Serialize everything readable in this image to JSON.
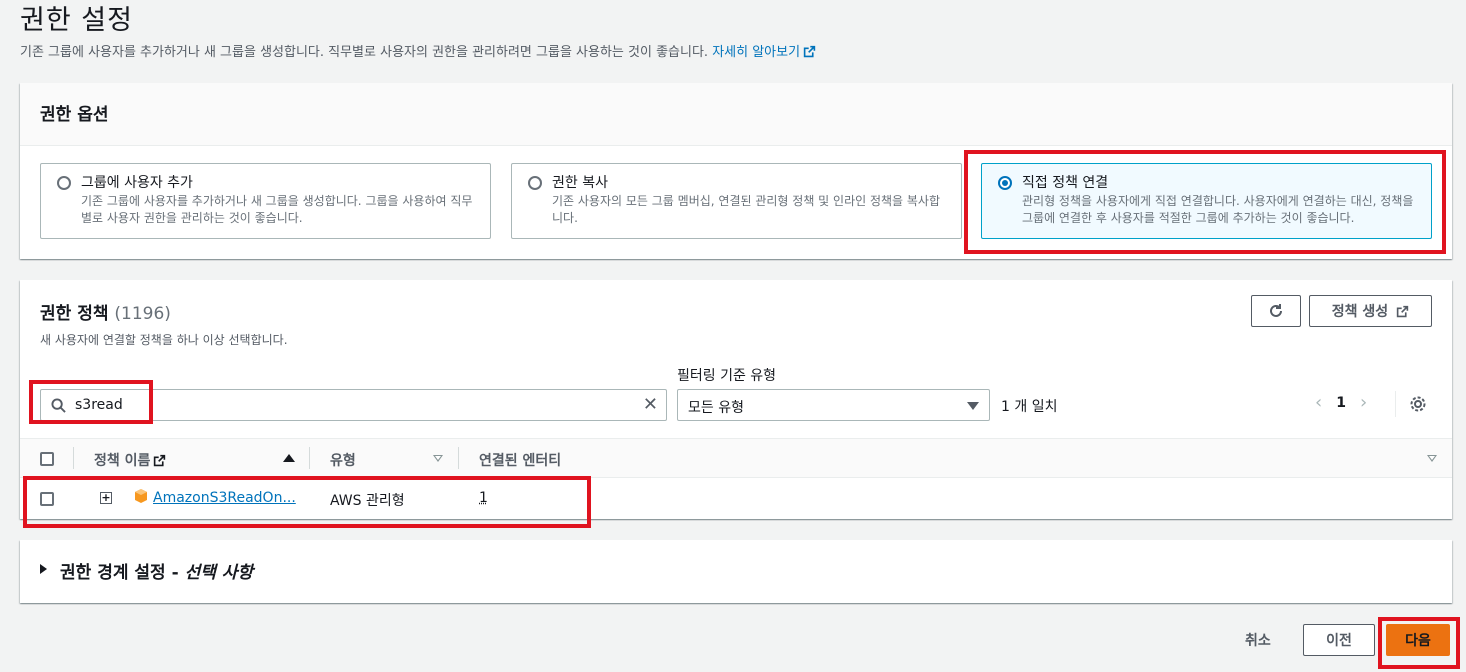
{
  "page": {
    "title": "권한 설정",
    "description": "기존 그룹에 사용자를 추가하거나 새 그룹을 생성합니다. 직무별로 사용자의 권한을 관리하려면 그룹을 사용하는 것이 좋습니다.",
    "learn_more": "자세히 알아보기"
  },
  "options": {
    "header": "권한 옵션",
    "tiles": [
      {
        "label": "그룹에 사용자 추가",
        "desc": "기존 그룹에 사용자를 추가하거나 새 그룹을 생성합니다. 그룹을 사용하여 직무별로 사용자 권한을 관리하는 것이 좋습니다.",
        "selected": false
      },
      {
        "label": "권한 복사",
        "desc": "기존 사용자의 모든 그룹 멤버십, 연결된 관리형 정책 및 인라인 정책을 복사합니다.",
        "selected": false
      },
      {
        "label": "직접 정책 연결",
        "desc": "관리형 정책을 사용자에게 직접 연결합니다. 사용자에게 연결하는 대신, 정책을 그룹에 연결한 후 사용자를 적절한 그룹에 추가하는 것이 좋습니다.",
        "selected": true
      }
    ]
  },
  "policies": {
    "title": "권한 정책",
    "count": "(1196)",
    "description": "새 사용자에 연결할 정책을 하나 이상 선택합니다.",
    "create_button": "정책 생성",
    "search_value": "s3read",
    "filter_label": "필터링 기준 유형",
    "filter_value": "모든 유형",
    "matches": "1 개 일치",
    "page": "1",
    "columns": [
      "정책 이름",
      "유형",
      "연결된 엔터티"
    ],
    "rows": [
      {
        "name": "AmazonS3ReadOn...",
        "type": "AWS 관리형",
        "entities": "1"
      }
    ]
  },
  "boundary": {
    "title": "권한 경계 설정 - ",
    "title_italic": "선택 사항"
  },
  "footer": {
    "cancel": "취소",
    "previous": "이전",
    "next": "다음"
  },
  "colors": {
    "link": "#0073bb",
    "primary_button": "#ec7211",
    "highlight": "#e0131f",
    "selected_tile_border": "#00a1c9"
  }
}
